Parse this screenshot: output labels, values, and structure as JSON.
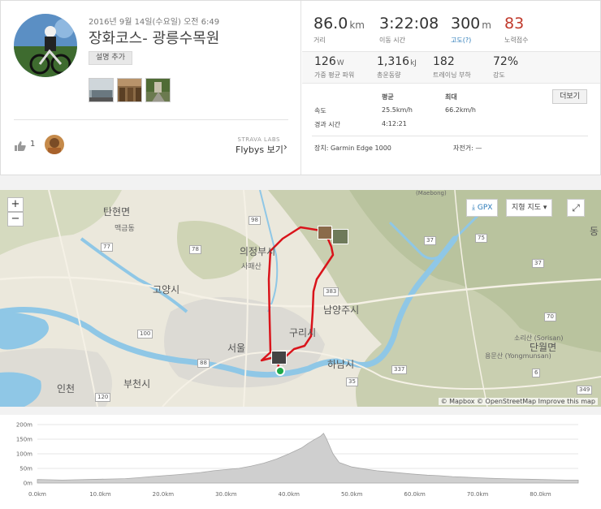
{
  "activity": {
    "date": "2016년 9월 14일(수요일) 오전 6:49",
    "title": "장화코스- 광릉수목원",
    "add_description": "설명 추가",
    "kudos_count": "1",
    "strava_labs": "STRAVA LABS",
    "flybys": "Flybys 보기"
  },
  "stats": {
    "distance": {
      "value": "86.0",
      "unit": "km",
      "label": "거리"
    },
    "moving_time": {
      "value": "3:22:08",
      "label": "이동 시간"
    },
    "elevation": {
      "value": "300",
      "unit": "m",
      "label": "고도(?)"
    },
    "effort": {
      "value": "83",
      "label": "노력점수"
    },
    "weighted_power": {
      "value": "126",
      "unit": "W",
      "label": "가중 평균 파워"
    },
    "work": {
      "value": "1,316",
      "unit": "kJ",
      "label": "총운동량"
    },
    "training_load": {
      "value": "182",
      "label": "트레이닝 부하"
    },
    "intensity": {
      "value": "72%",
      "label": "강도"
    },
    "table": {
      "avg_header": "평균",
      "max_header": "최대",
      "speed_label": "속도",
      "speed_avg": "25.5km/h",
      "speed_max": "66.2km/h",
      "elapsed_label": "경과 시간",
      "elapsed_value": "4:12:21"
    },
    "more_button": "더보기",
    "device": "장치: Garmin Edge 1000",
    "bike": "자전거: —"
  },
  "map": {
    "zoom_in": "+",
    "zoom_out": "−",
    "gpx_label": "GPX",
    "terrain_label": "지형 지도",
    "attribution": "© Mapbox © OpenStreetMap Improve this map",
    "cities": [
      "탄현면",
      "맥금동",
      "의정부시",
      "고양시",
      "남양주시",
      "구리시",
      "서울",
      "하남시",
      "부천시",
      "인천",
      "단월면"
    ],
    "towns": [
      "사패산",
      "소리산 (Sorisan)",
      "용문산 (Yongmunsan)",
      "(Maebong)",
      "동"
    ],
    "road_shields": [
      "77",
      "78",
      "98",
      "75",
      "37",
      "383",
      "70",
      "100",
      "88",
      "35",
      "337",
      "6",
      "349",
      "120",
      "37"
    ],
    "route_color": "#d9141b"
  },
  "elevation_chart": {
    "y_ticks": [
      "200m",
      "150m",
      "100m",
      "50m",
      "0m"
    ],
    "x_ticks": [
      "0.0km",
      "10.0km",
      "20.0km",
      "30.0km",
      "40.0km",
      "50.0km",
      "60.0km",
      "70.0km",
      "80.0km"
    ]
  },
  "chart_data": {
    "type": "area",
    "xlabel": "",
    "ylabel": "",
    "xlim": [
      0,
      86
    ],
    "ylim": [
      0,
      200
    ],
    "x": [
      0,
      2,
      4,
      6,
      8,
      10,
      12,
      14,
      16,
      18,
      20,
      22,
      24,
      26,
      28,
      30,
      32,
      34,
      36,
      38,
      40,
      42,
      43,
      44,
      45,
      45.5,
      46,
      47,
      48,
      50,
      52,
      54,
      56,
      58,
      60,
      62,
      64,
      66,
      68,
      70,
      72,
      74,
      76,
      78,
      80,
      82,
      84,
      86
    ],
    "series": [
      {
        "values": [
          12,
          11,
          10,
          11,
          12,
          13,
          14,
          15,
          18,
          22,
          25,
          28,
          32,
          36,
          42,
          46,
          50,
          58,
          68,
          82,
          100,
          120,
          135,
          148,
          160,
          170,
          150,
          100,
          70,
          55,
          48,
          42,
          38,
          34,
          30,
          27,
          25,
          22,
          20,
          18,
          16,
          15,
          14,
          13,
          12,
          11,
          10,
          10
        ]
      }
    ]
  }
}
